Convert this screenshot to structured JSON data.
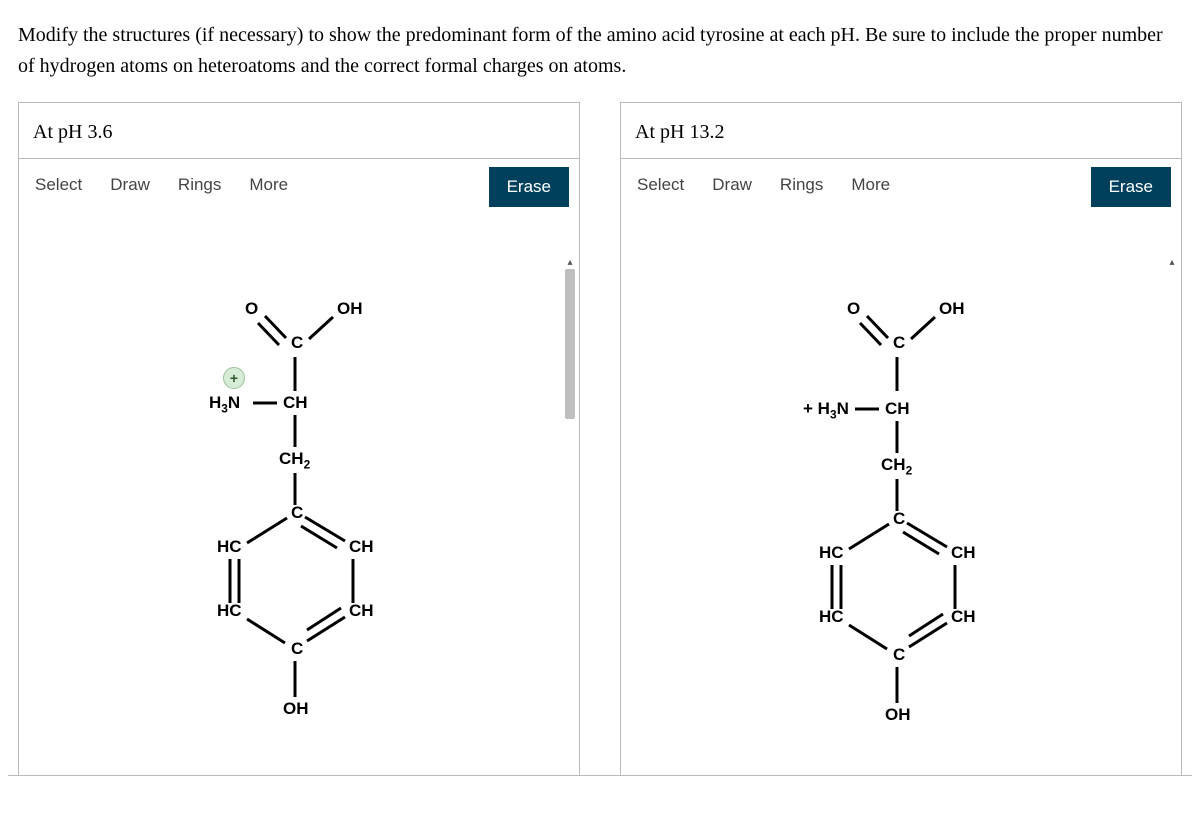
{
  "question": "Modify the structures (if necessary) to show the predominant form of the amino acid tyrosine at each pH. Be sure to include the proper number of hydrogen atoms on heteroatoms and the correct formal charges on atoms.",
  "toolbar": {
    "select": "Select",
    "draw": "Draw",
    "rings": "Rings",
    "more": "More",
    "erase": "Erase"
  },
  "panels": [
    {
      "title": "At pH 3.6",
      "structure": {
        "O": "O",
        "OH_top": "OH",
        "C_top": "C",
        "amine": "H<sub class=\"sub\">3</sub>N",
        "CH": "CH",
        "CH2": "CH<sub class=\"sub\">2</sub>",
        "C_ring_top": "C",
        "HC_ul": "HC",
        "CH_ur": "CH",
        "HC_ll": "HC",
        "CH_lr": "CH",
        "C_ring_bot": "C",
        "OH_bot": "OH",
        "charge": "+"
      }
    },
    {
      "title": "At pH 13.2",
      "structure": {
        "O": "O",
        "OH_top": "OH",
        "C_top": "C",
        "amine": "+ H<sub class=\"sub\">3</sub>N",
        "CH": "CH",
        "CH2": "CH<sub class=\"sub\">2</sub>",
        "C_ring_top": "C",
        "HC_ul": "HC",
        "CH_ur": "CH",
        "HC_ll": "HC",
        "CH_lr": "CH",
        "C_ring_bot": "C",
        "OH_bot": "OH"
      }
    }
  ]
}
